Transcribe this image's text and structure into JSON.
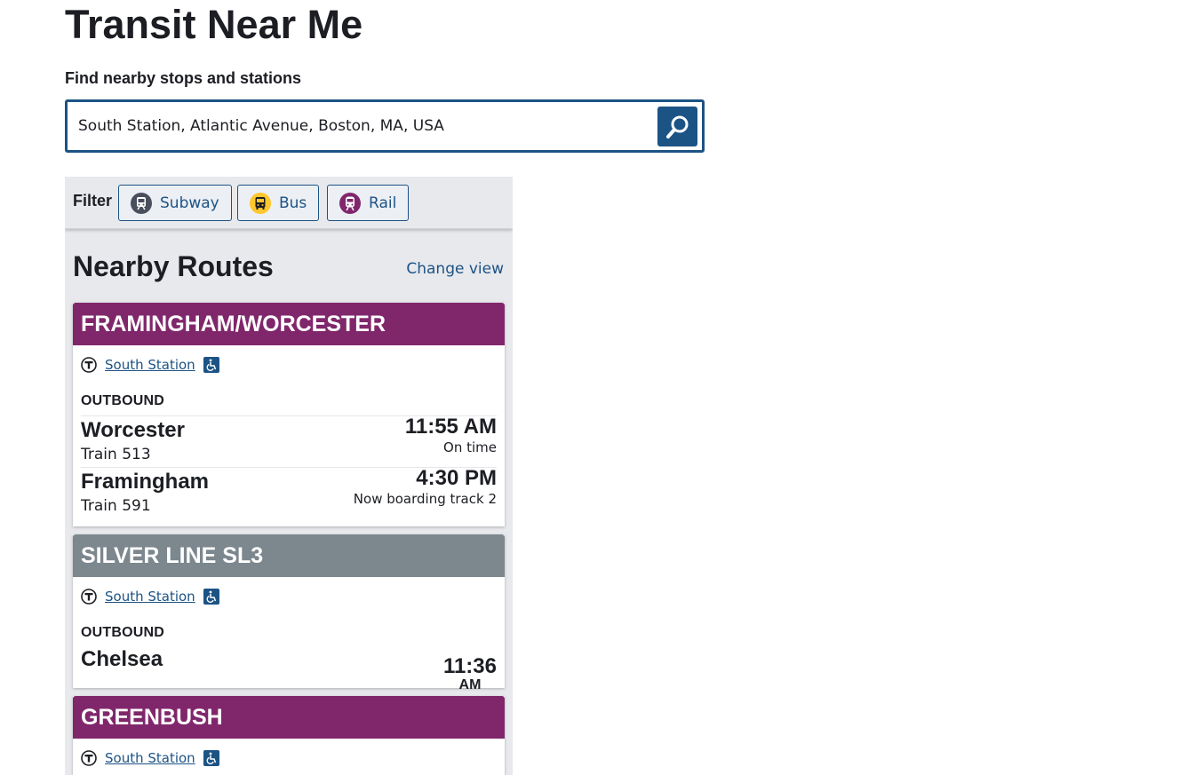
{
  "page": {
    "title": "Transit Near Me",
    "search_label": "Find nearby stops and stations",
    "search_value": "South Station, Atlantic Avenue, Boston, MA, USA"
  },
  "filter": {
    "label": "Filter",
    "buttons": [
      {
        "label": "Subway",
        "icon": "subway-icon",
        "color": "#494f5c"
      },
      {
        "label": "Bus",
        "icon": "bus-icon",
        "color": "#ffc72c"
      },
      {
        "label": "Rail",
        "icon": "rail-icon",
        "color": "#80276c"
      }
    ]
  },
  "nearby": {
    "heading": "Nearby Routes",
    "change_view": "Change view"
  },
  "routes": [
    {
      "name": "FRAMINGHAM/WORCESTER",
      "color": "#80276c",
      "stop": "South Station",
      "direction": "OUTBOUND",
      "trips": [
        {
          "destination": "Worcester",
          "vehicle": "Train 513",
          "time": "11:55 AM",
          "status": "On time"
        },
        {
          "destination": "Framingham",
          "vehicle": "Train 591",
          "time": "4:30 PM",
          "status": "Now boarding track 2"
        }
      ]
    },
    {
      "name": "SILVER LINE SL3",
      "color": "#7c878e",
      "stop": "South Station",
      "direction": "OUTBOUND",
      "trips": [
        {
          "destination": "Chelsea",
          "time_hm": "11:36",
          "time_ampm": "AM"
        }
      ]
    },
    {
      "name": "GREENBUSH",
      "color": "#80276c",
      "stop": "South Station"
    }
  ]
}
